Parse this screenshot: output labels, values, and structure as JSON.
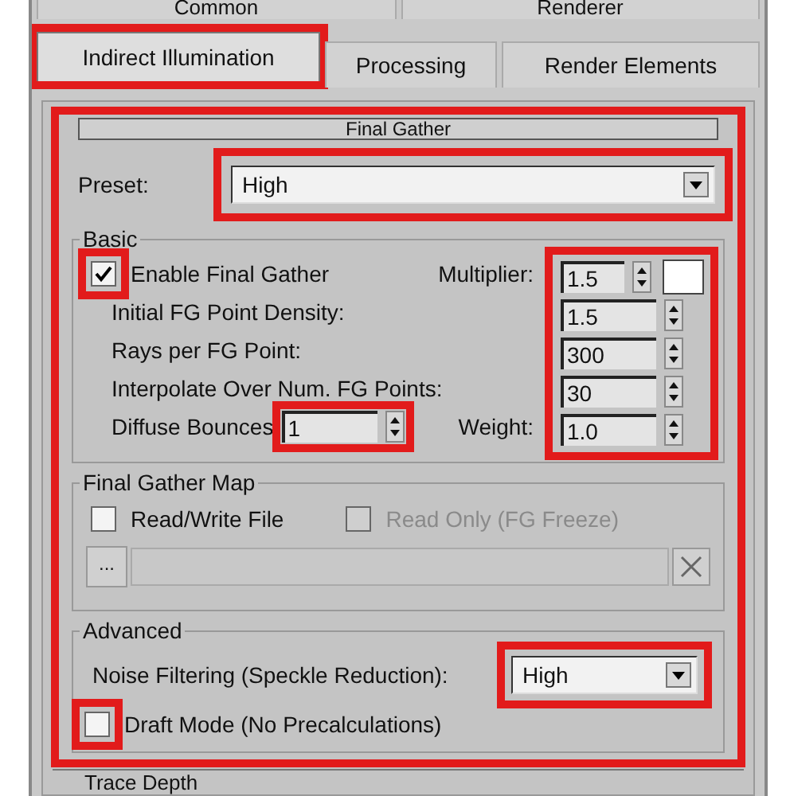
{
  "tabs_row_1": [
    {
      "label": "Common",
      "selected": false,
      "highlighted": false
    },
    {
      "label": "Renderer",
      "selected": false,
      "highlighted": false
    }
  ],
  "tabs_row_2": [
    {
      "label": "Indirect Illumination",
      "selected": true,
      "highlighted": true
    },
    {
      "label": "Processing",
      "selected": false,
      "highlighted": false
    },
    {
      "label": "Render Elements",
      "selected": false,
      "highlighted": false
    }
  ],
  "rollout": {
    "title": "Final Gather",
    "highlighted": true,
    "preset": {
      "label": "Preset:",
      "value": "High",
      "highlighted": true
    },
    "basic": {
      "title": "Basic",
      "values_highlighted": true,
      "enable": {
        "label": "Enable Final Gather",
        "checked": true,
        "highlighted": true
      },
      "multiplier": {
        "label": "Multiplier:",
        "value": "1.5"
      },
      "rows": [
        {
          "label": "Initial FG Point Density:",
          "value": "1.5"
        },
        {
          "label": "Rays per FG Point:",
          "value": "300"
        },
        {
          "label": "Interpolate Over Num. FG Points:",
          "value": "30"
        }
      ],
      "diffuse": {
        "label": "Diffuse Bounces",
        "value": "1",
        "highlighted": true
      },
      "weight": {
        "label": "Weight:",
        "value": "1.0"
      }
    },
    "map": {
      "title": "Final Gather Map",
      "options": [
        {
          "label": "Read/Write File",
          "checked": false,
          "disabled": false
        },
        {
          "label": "Read Only (FG Freeze)",
          "checked": false,
          "disabled": true
        }
      ],
      "browse": "..."
    },
    "advanced": {
      "title": "Advanced",
      "noise": {
        "label": "Noise Filtering (Speckle Reduction):",
        "value": "High",
        "highlighted": true
      },
      "draft": {
        "label": "Draft Mode (No Precalculations)",
        "checked": false,
        "highlighted": true
      }
    }
  },
  "next_rollout": {
    "title": "Trace Depth"
  }
}
